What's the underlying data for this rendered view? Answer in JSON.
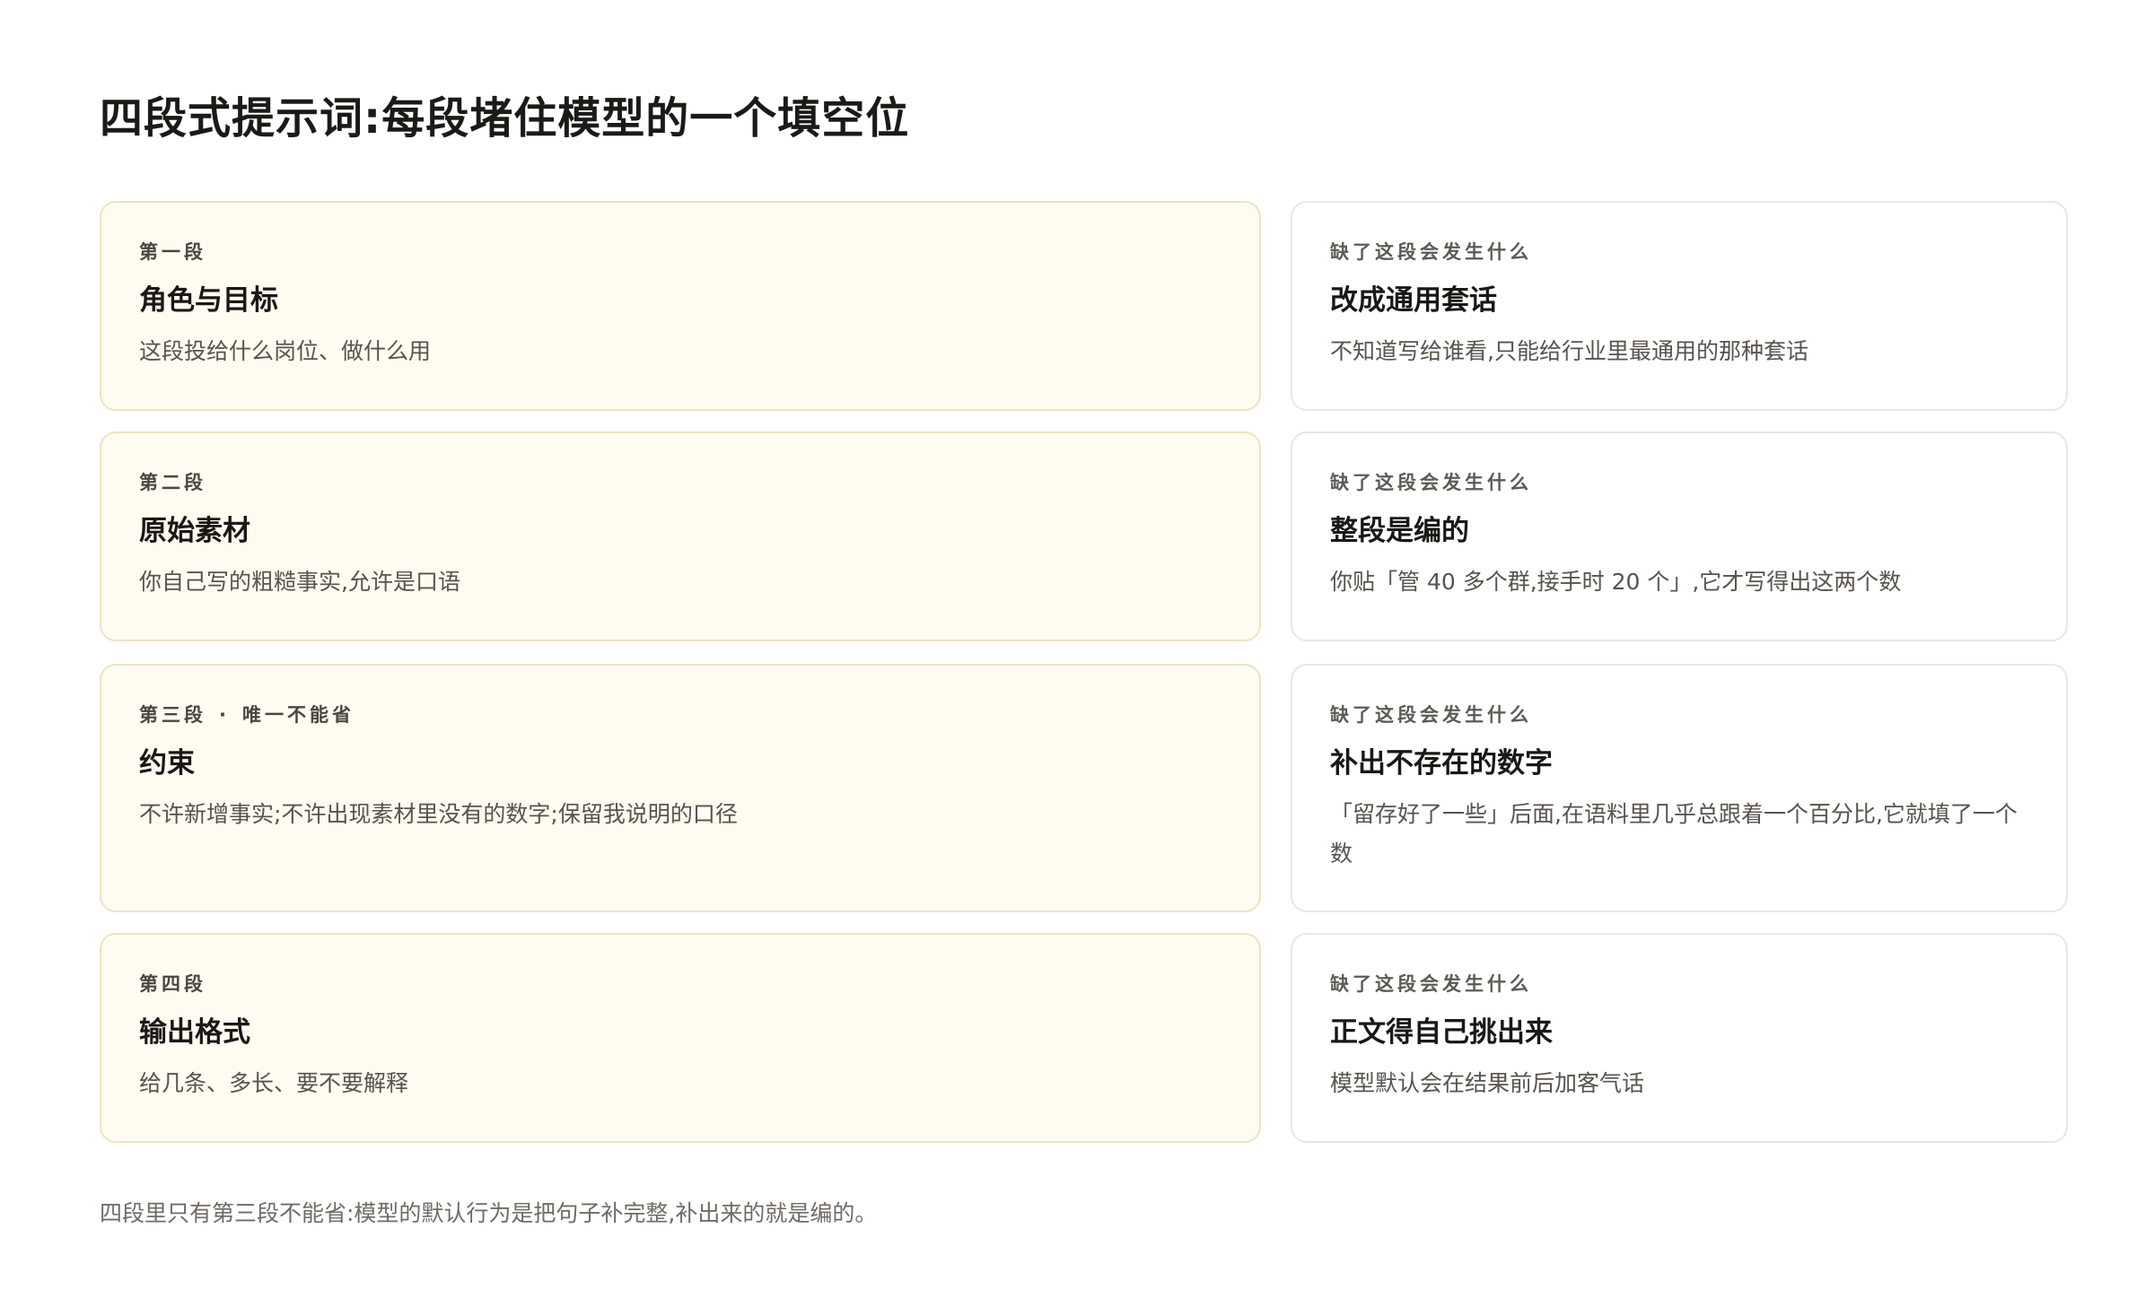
{
  "title": "四段式提示词:每段堵住模型的一个填空位",
  "rows": [
    {
      "segment": {
        "tag": "第一段",
        "tag_extra": "",
        "heading": "角色与目标",
        "desc": "这段投给什么岗位、做什么用"
      },
      "effect": {
        "tag": "缺了这段会发生什么",
        "heading": "改成通用套话",
        "desc": "不知道写给谁看,只能给行业里最通用的那种套话"
      }
    },
    {
      "segment": {
        "tag": "第二段",
        "tag_extra": "",
        "heading": "原始素材",
        "desc": "你自己写的粗糙事实,允许是口语"
      },
      "effect": {
        "tag": "缺了这段会发生什么",
        "heading": "整段是编的",
        "desc": "你贴「管 40 多个群,接手时 20 个」,它才写得出这两个数"
      }
    },
    {
      "segment": {
        "tag": "第三段",
        "tag_extra": "唯一不能省",
        "heading": "约束",
        "desc": "不许新增事实;不许出现素材里没有的数字;保留我说明的口径"
      },
      "effect": {
        "tag": "缺了这段会发生什么",
        "heading": "补出不存在的数字",
        "desc": "「留存好了一些」后面,在语料里几乎总跟着一个百分比,它就填了一个数"
      }
    },
    {
      "segment": {
        "tag": "第四段",
        "tag_extra": "",
        "heading": "输出格式",
        "desc": "给几条、多长、要不要解释"
      },
      "effect": {
        "tag": "缺了这段会发生什么",
        "heading": "正文得自己挑出来",
        "desc": "模型默认会在结果前后加客气话"
      }
    }
  ],
  "footnote": "四段里只有第三段不能省:模型的默认行为是把句子补完整,补出来的就是编的。",
  "colors": {
    "segment_bg": "#fefbf1",
    "segment_border": "#eee3c2",
    "effect_bg": "#ffffff",
    "effect_border": "#e9e7e2"
  }
}
